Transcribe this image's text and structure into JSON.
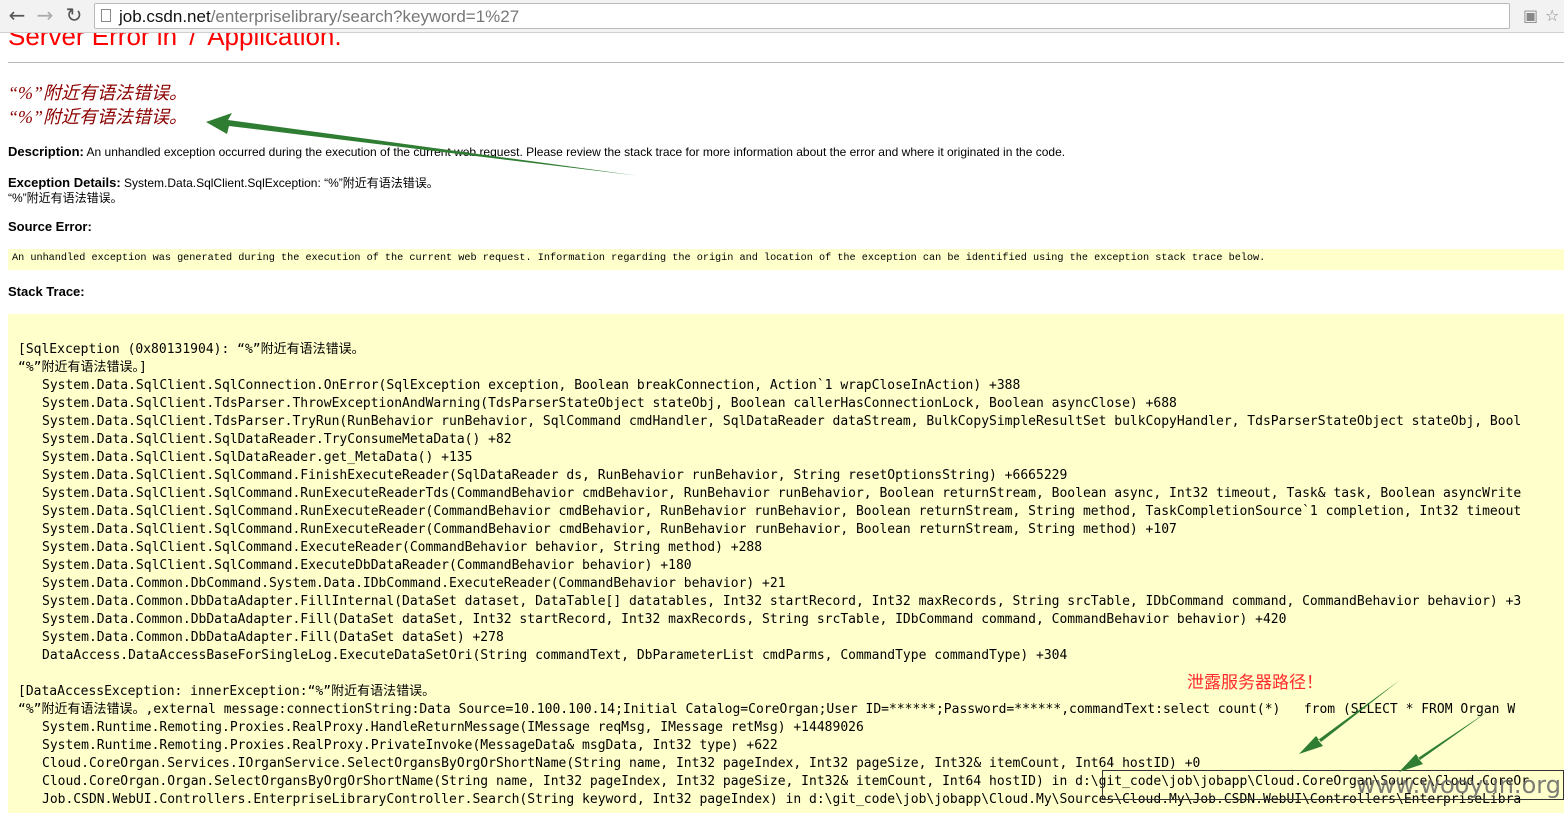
{
  "browser": {
    "url_host": "job.csdn.net",
    "url_path": "/enterpriselibrary/search?keyword=1%27"
  },
  "page": {
    "title": "Server Error in '/' Application.",
    "error_heading_1": "“%”附近有语法错误。",
    "error_heading_2": "“%”附近有语法错误。",
    "description_label": "Description:",
    "description_text": "An unhandled exception occurred during the execution of the current web request. Please review the stack trace for more information about the error and where it originated in the code.",
    "exception_label": "Exception Details:",
    "exception_text": "System.Data.SqlClient.SqlException: “%”附近有语法错误。",
    "exception_text_2": "“%”附近有语法错误。",
    "source_error_label": "Source Error:",
    "source_error_text": "An unhandled exception was generated during the execution of the current web request. Information regarding the origin and location of the exception can be identified using the exception stack trace below.",
    "stack_trace_label": "Stack Trace:"
  },
  "stack_trace": {
    "lines": [
      "[SqlException (0x80131904): “%”附近有语法错误。",
      "“%”附近有语法错误。]",
      "System.Data.SqlClient.SqlConnection.OnError(SqlException exception, Boolean breakConnection, Action`1 wrapCloseInAction) +388",
      "System.Data.SqlClient.TdsParser.ThrowExceptionAndWarning(TdsParserStateObject stateObj, Boolean callerHasConnectionLock, Boolean asyncClose) +688",
      "System.Data.SqlClient.TdsParser.TryRun(RunBehavior runBehavior, SqlCommand cmdHandler, SqlDataReader dataStream, BulkCopySimpleResultSet bulkCopyHandler, TdsParserStateObject stateObj, Bool",
      "System.Data.SqlClient.SqlDataReader.TryConsumeMetaData() +82",
      "System.Data.SqlClient.SqlDataReader.get_MetaData() +135",
      "System.Data.SqlClient.SqlCommand.FinishExecuteReader(SqlDataReader ds, RunBehavior runBehavior, String resetOptionsString) +6665229",
      "System.Data.SqlClient.SqlCommand.RunExecuteReaderTds(CommandBehavior cmdBehavior, RunBehavior runBehavior, Boolean returnStream, Boolean async, Int32 timeout, Task& task, Boolean asyncWrite",
      "System.Data.SqlClient.SqlCommand.RunExecuteReader(CommandBehavior cmdBehavior, RunBehavior runBehavior, Boolean returnStream, String method, TaskCompletionSource`1 completion, Int32 timeout",
      "System.Data.SqlClient.SqlCommand.RunExecuteReader(CommandBehavior cmdBehavior, RunBehavior runBehavior, Boolean returnStream, String method) +107",
      "System.Data.SqlClient.SqlCommand.ExecuteReader(CommandBehavior behavior, String method) +288",
      "System.Data.SqlClient.SqlCommand.ExecuteDbDataReader(CommandBehavior behavior) +180",
      "System.Data.Common.DbCommand.System.Data.IDbCommand.ExecuteReader(CommandBehavior behavior) +21",
      "System.Data.Common.DbDataAdapter.FillInternal(DataSet dataset, DataTable[] datatables, Int32 startRecord, Int32 maxRecords, String srcTable, IDbCommand command, CommandBehavior behavior) +3",
      "System.Data.Common.DbDataAdapter.Fill(DataSet dataSet, Int32 startRecord, Int32 maxRecords, String srcTable, IDbCommand command, CommandBehavior behavior) +420",
      "System.Data.Common.DbDataAdapter.Fill(DataSet dataSet) +278",
      "DataAccess.DataAccessBaseForSingleLog.ExecuteDataSetOri(String commandText, DbParameterList cmdParms, CommandType commandType) +304",
      "[DataAccessException: innerException:“%”附近有语法错误。",
      "“%”附近有语法错误。,external message:connectionString:Data Source=10.100.100.14;Initial Catalog=CoreOrgan;User ID=******;Password=******,commandText:select count(*)   from (SELECT * FROM Organ W",
      "System.Runtime.Remoting.Proxies.RealProxy.HandleReturnMessage(IMessage reqMsg, IMessage retMsg) +14489026",
      "System.Runtime.Remoting.Proxies.RealProxy.PrivateInvoke(MessageData& msgData, Int32 type) +622",
      "Cloud.CoreOrgan.Services.IOrganService.SelectOrgansByOrgOrShortName(String name, Int32 pageIndex, Int32 pageSize, Int32& itemCount, Int64 hostID) +0",
      "Cloud.CoreOrgan.Organ.SelectOrgansByOrgOrShortName(String name, Int32 pageIndex, Int32 pageSize, Int32& itemCount, Int64 hostID) in d:\\git_code\\job\\jobapp\\Cloud.CoreOrgan\\Source\\Cloud.CoreOr",
      "Job.CSDN.WebUI.Controllers.EnterpriseLibraryController.Search(String keyword, Int32 pageIndex) in d:\\git_code\\job\\jobapp\\Cloud.My\\Sources\\Cloud.My\\Job.CSDN.WebUI\\Controllers\\EnterpriseLibra"
    ]
  },
  "annotations": {
    "leak_note": "泄露服务器路径！",
    "watermark": "www.wooyun.org",
    "arrow_color": "#2e7d32"
  }
}
